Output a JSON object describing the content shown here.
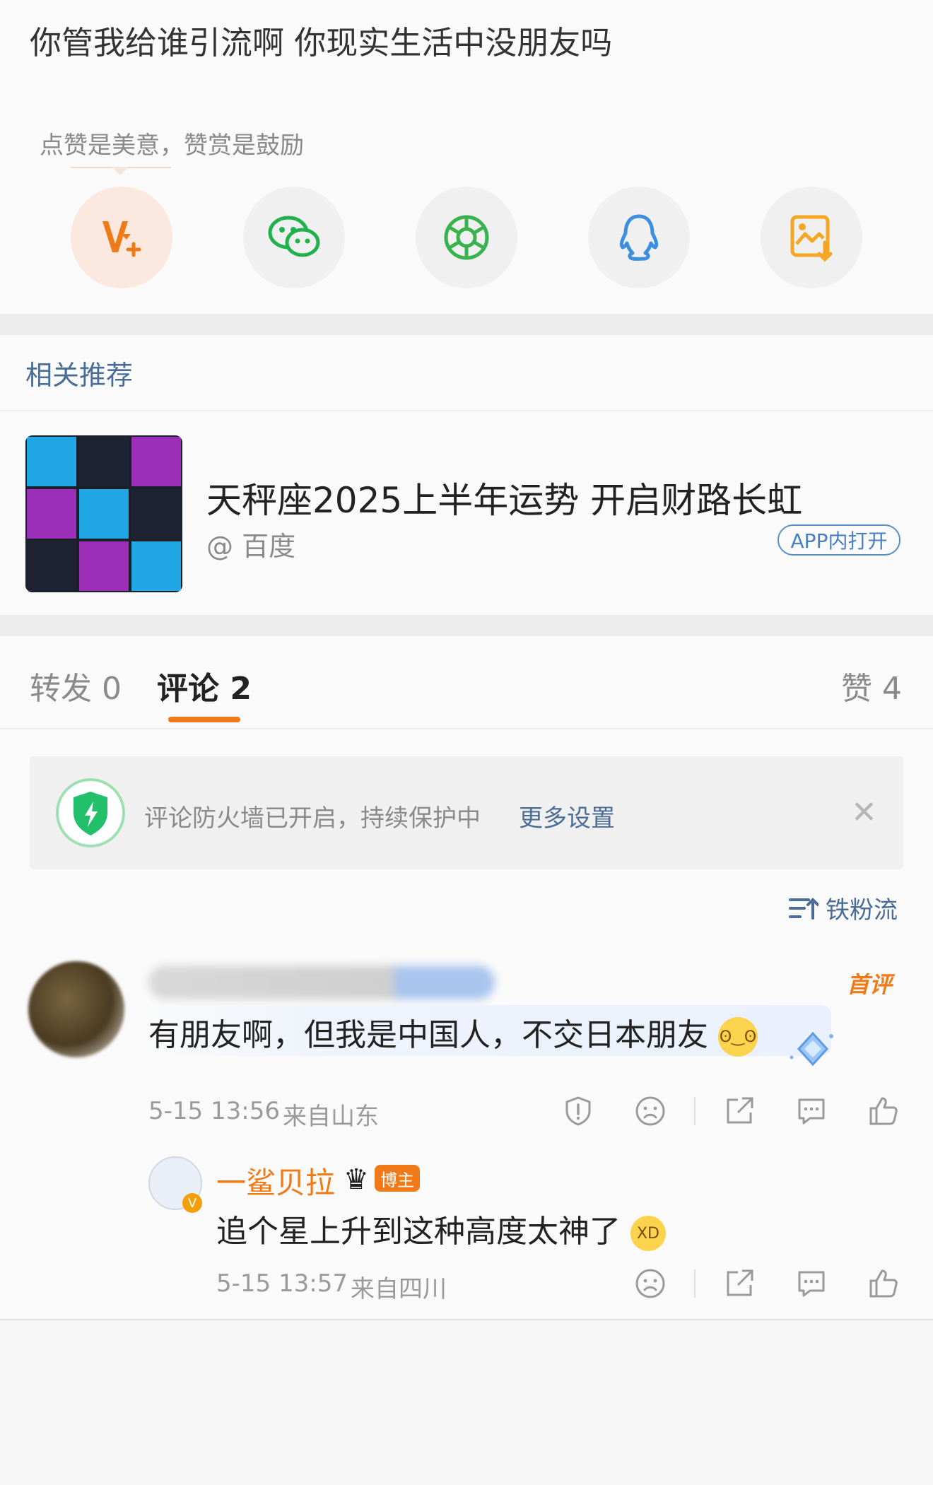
{
  "post": {
    "text": "你管我给谁引流啊 你现实生活中没朋友吗"
  },
  "reward": {
    "label": "点赞是美意，赞赏是鼓励",
    "share_buttons": [
      {
        "icon": "v-plus-icon",
        "color": "#f07a18"
      },
      {
        "icon": "wechat-icon",
        "color": "#22b14c"
      },
      {
        "icon": "moments-icon",
        "color": "#37b24d"
      },
      {
        "icon": "qq-icon",
        "color": "#3b8fe0"
      },
      {
        "icon": "save-image-icon",
        "color": "#f5a623"
      }
    ]
  },
  "related": {
    "section_title": "相关推荐",
    "item": {
      "headline": "天秤座2025上半年运势 开启财路长虹",
      "source": "@ 百度",
      "open_button": "APP内打开"
    }
  },
  "tabs": {
    "repost": "转发 0",
    "comments": "评论 2",
    "likes": "赞 4"
  },
  "firewall": {
    "text": "评论防火墙已开启，持续保护中",
    "link": "更多设置"
  },
  "sort": {
    "label": "铁粉流"
  },
  "comment1": {
    "badge": "首评",
    "text": "有朋友啊，但我是中国人，不交日本朋友",
    "date": "5-15 13:56",
    "location": "来自山东"
  },
  "reply1": {
    "author": "一鲨贝拉",
    "badge": "博主",
    "text": "追个星上升到这种高度太神了",
    "date": "5-15 13:57",
    "location": "来自四川"
  },
  "colors": {
    "accent": "#f07a18",
    "link": "#4a6d95",
    "muted": "#8a8a8a"
  }
}
